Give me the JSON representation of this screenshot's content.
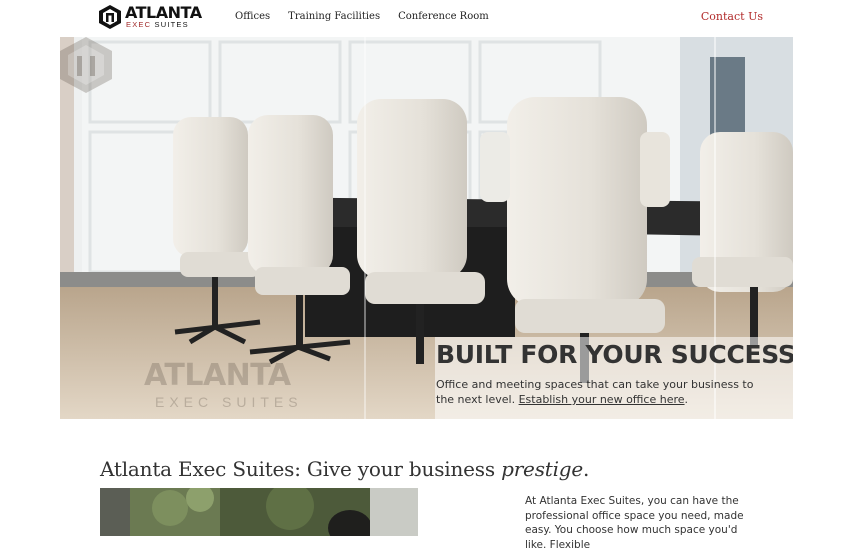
{
  "header": {
    "logo_word": "ATLANTA",
    "logo_exec": "EXEC",
    "logo_suites": "SUITES",
    "nav": [
      "Offices",
      "Training Facilities",
      "Conference Room"
    ],
    "contact": "Contact Us"
  },
  "hero": {
    "title": "BUILT FOR YOUR SUCCESS",
    "text": "Office and meeting spaces that can take your business to the next level. ",
    "link": "Establish your new office here",
    "text_end": ".",
    "watermark_word": "ATLANTA",
    "watermark_sub": "EXEC SUITES"
  },
  "content": {
    "headline": "Atlanta Exec Suites: Give your business ",
    "headline_em": "prestige",
    "headline_end": ".",
    "body": "At Atlanta Exec Suites, you can have the professional office space you need, made easy. You choose how much space you'd like. Flexible"
  },
  "colors": {
    "accent": "#b22b2b",
    "text": "#333333"
  }
}
